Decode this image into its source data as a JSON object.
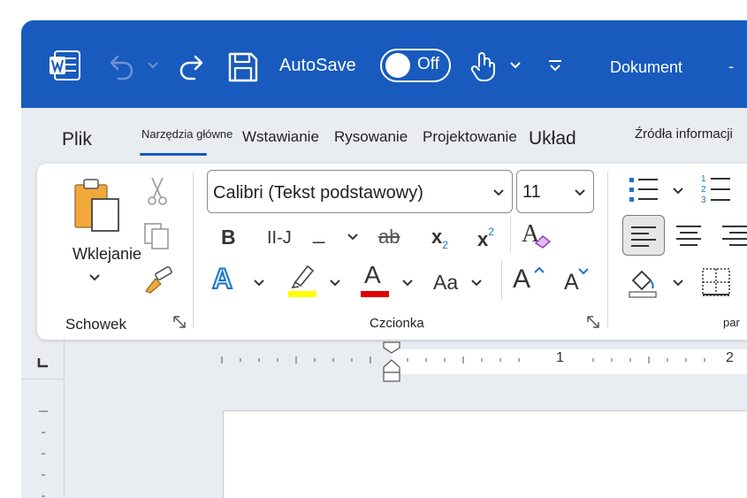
{
  "titlebar": {
    "autosave_label": "AutoSave",
    "autosave_toggle": "Off",
    "document_name": "Dokument",
    "minimize_symbol": "-"
  },
  "tabs": {
    "file": "Plik",
    "home": "Narzędzia główne",
    "insert": "Wstawianie",
    "draw": "Rysowanie",
    "design": "Projektowanie",
    "layout": "Układ",
    "references": "Źródła informacji"
  },
  "clipboard": {
    "paste_label": "Wklejanie",
    "group_label": "Schowek"
  },
  "font": {
    "font_name": "Calibri (Tekst podstawowy)",
    "font_size": "11",
    "bold_glyph": "B",
    "italic_glyph": "II-J",
    "underline_glyph": "_",
    "strike_glyph": "ab",
    "subscript_glyph": "x",
    "subscript_mark": "2",
    "superscript_glyph": "x",
    "superscript_mark": "2",
    "case_glyph": "Aa",
    "grow_glyph": "A",
    "shrink_glyph": "A",
    "effects_glyph": "A",
    "font_color_glyph": "A",
    "clear_glyph": "A",
    "group_label": "Czcionka"
  },
  "paragraph": {
    "group_label": "par"
  },
  "ruler": {
    "mark_1": "1",
    "mark_2": "2"
  },
  "colors": {
    "title_blue": "#185abd",
    "highlight_yellow": "#ffff00",
    "font_red": "#e00000",
    "accent_blue": "#1e73c8"
  }
}
